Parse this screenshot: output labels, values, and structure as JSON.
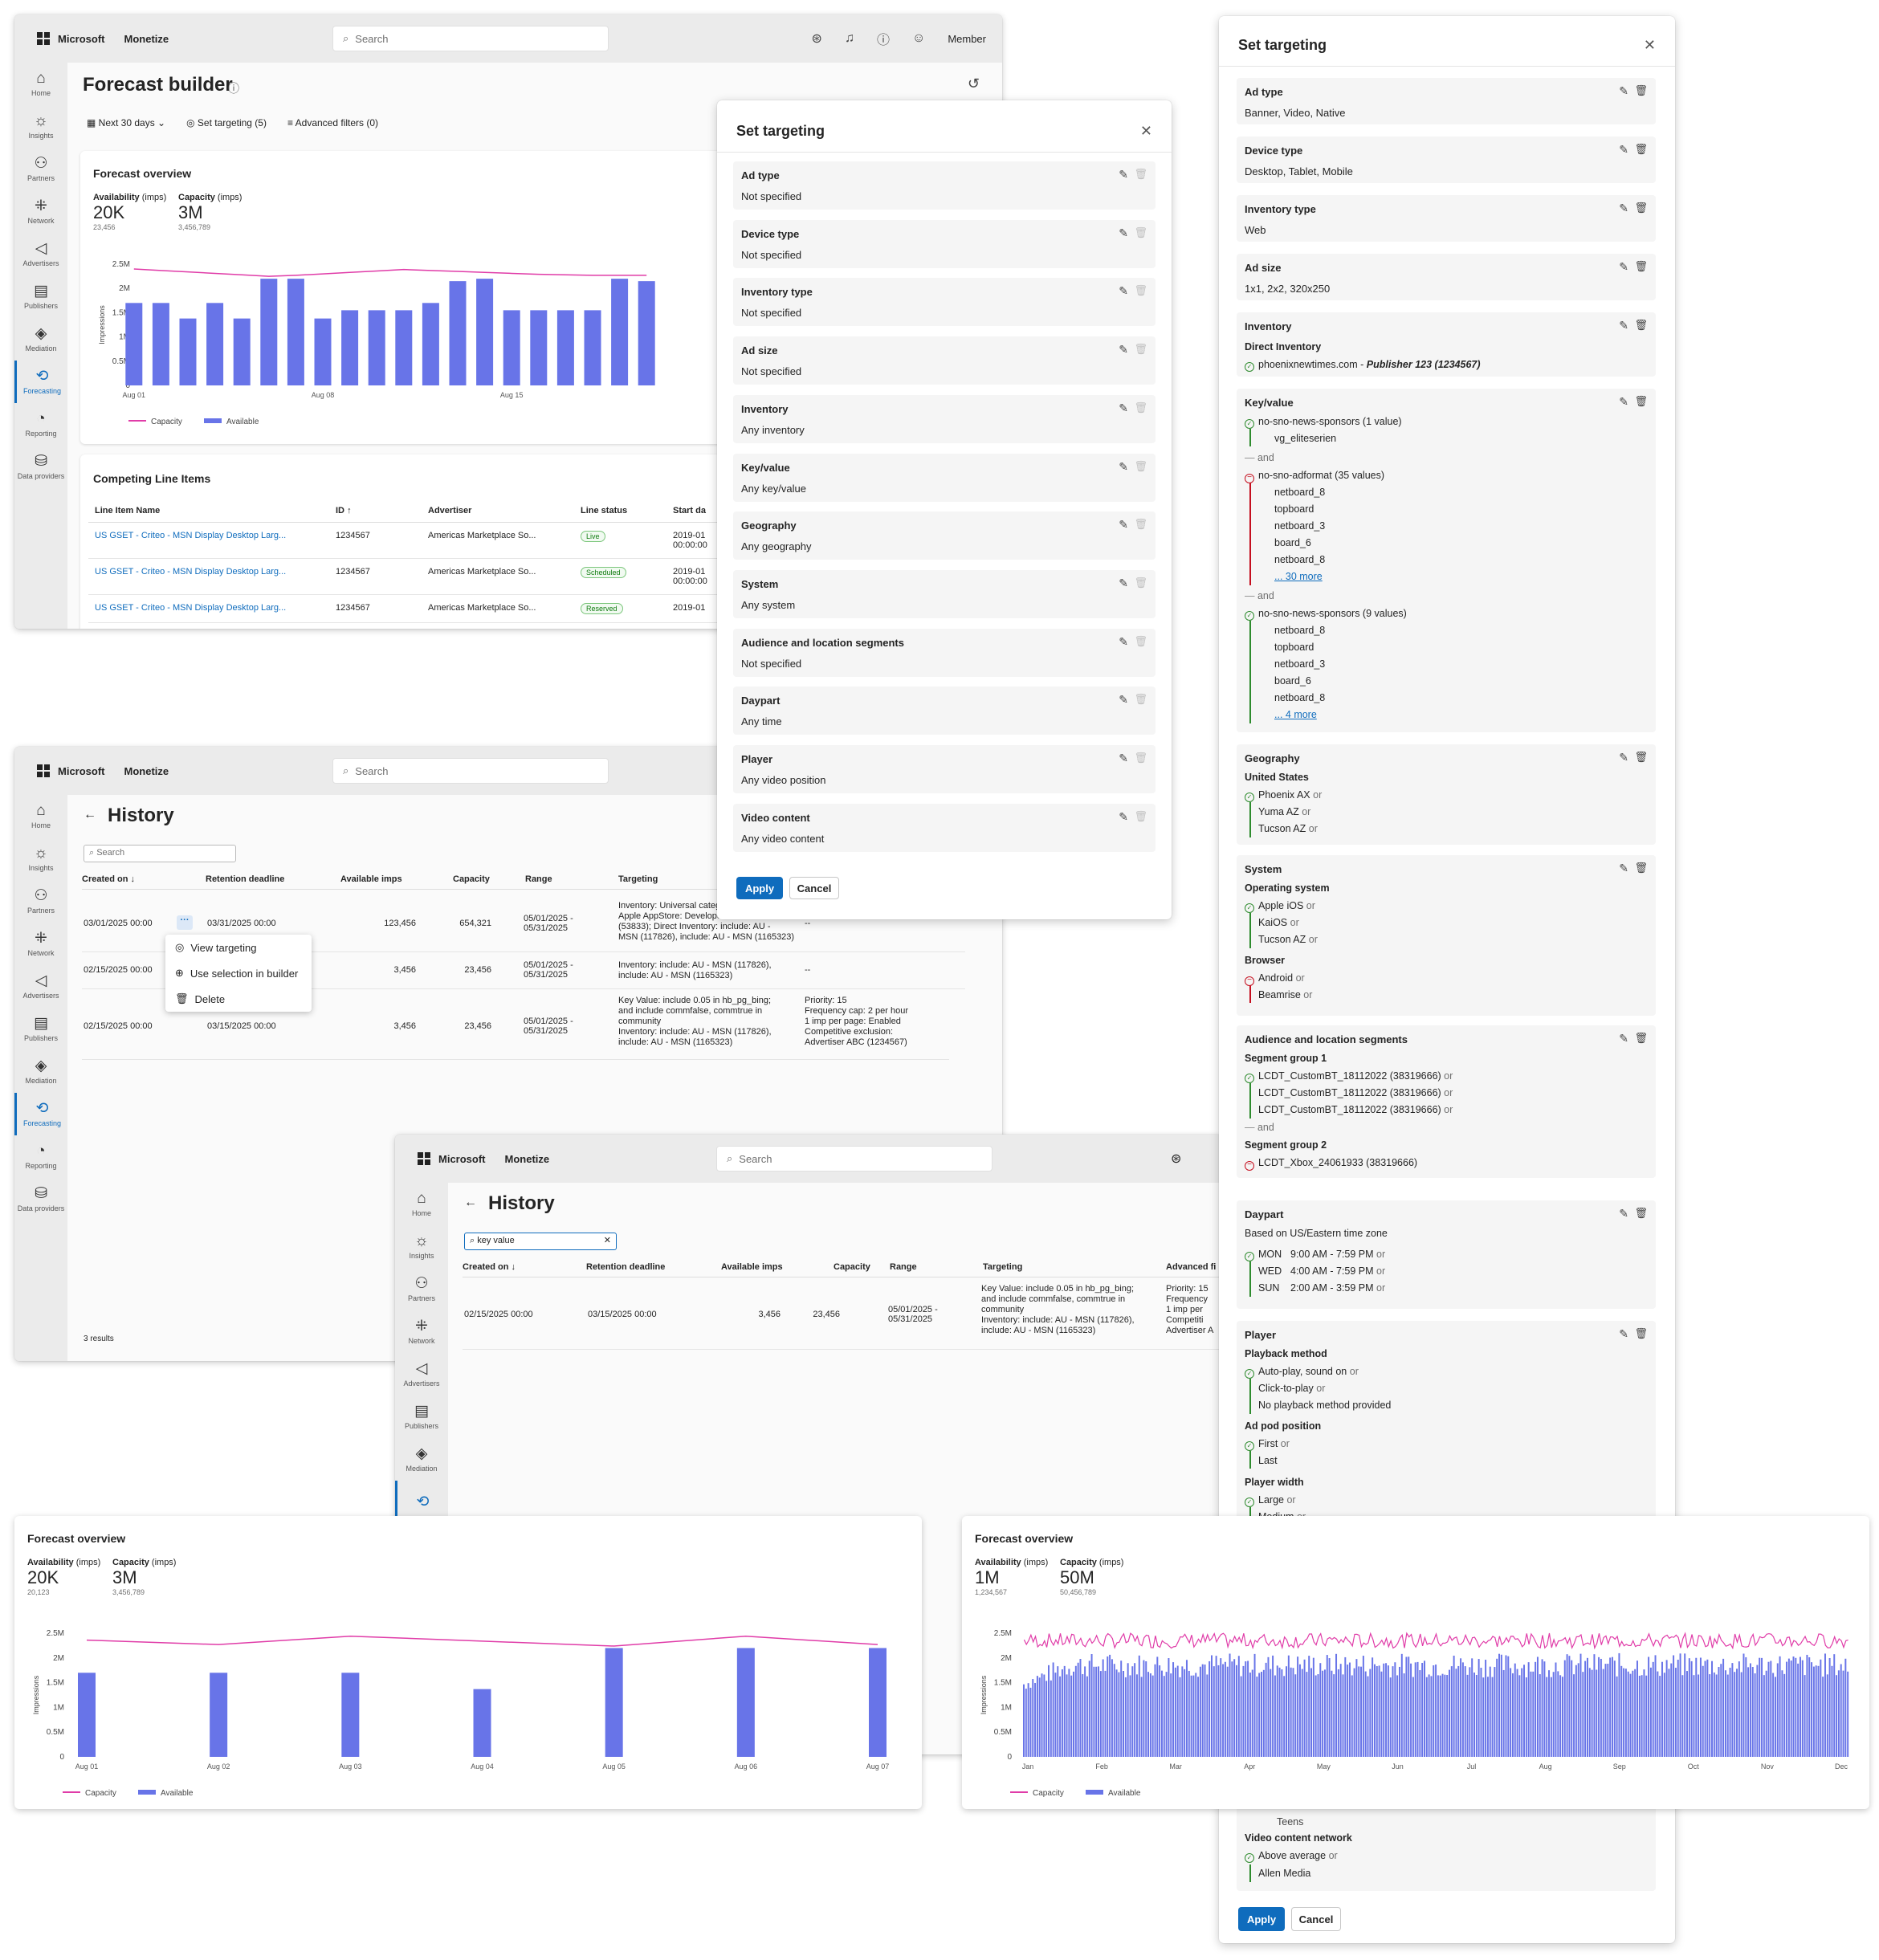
{
  "shell": {
    "brand": "Microsoft",
    "app": "Monetize",
    "search_placeholder": "Search",
    "member": "Member",
    "nav": [
      "Home",
      "Insights",
      "Partners",
      "Network",
      "Advertisers",
      "Publishers",
      "Mediation",
      "Forecasting",
      "Reporting",
      "Data providers"
    ],
    "active_nav": "Forecasting",
    "icons": {
      "home": "home-icon",
      "insights": "lightbulb-icon",
      "partners": "people-icon",
      "network": "network-icon",
      "advertisers": "megaphone-icon",
      "publishers": "news-icon",
      "mediation": "handshake-icon",
      "forecasting": "forecast-icon",
      "reporting": "report-icon",
      "data_providers": "database-icon"
    }
  },
  "forecast_builder": {
    "title": "Forecast builder",
    "filters": {
      "range": "Next 30 days",
      "targeting": "Set targeting (5)",
      "advanced": "Advanced filters (0)"
    },
    "overview_title": "Forecast overview",
    "availability_label": "Availability",
    "imps": "(imps)",
    "capacity_label": "Capacity",
    "availability_value": "20K",
    "availability_exact": "23,456",
    "capacity_value": "3M",
    "capacity_exact": "3,456,789",
    "competing_title": "Competing Line Items",
    "columns": [
      "Line Item Name",
      "ID",
      "Advertiser",
      "Line status",
      "Start da"
    ],
    "rows": [
      {
        "name": "US GSET - Criteo - MSN Display Desktop Larg...",
        "id": "1234567",
        "advertiser": "Americas Marketplace So...",
        "status": "Live",
        "start": "2019-01",
        "time": "00:00:00"
      },
      {
        "name": "US GSET - Criteo - MSN Display Desktop Larg...",
        "id": "1234567",
        "advertiser": "Americas Marketplace So...",
        "status": "Scheduled",
        "start": "2019-01",
        "time": "00:00:00"
      },
      {
        "name": "US GSET - Criteo - MSN Display Desktop Larg...",
        "id": "1234567",
        "advertiser": "Americas Marketplace So...",
        "status": "Reserved",
        "start": "2019-01",
        "time": ""
      }
    ]
  },
  "targeting_short": {
    "title": "Set targeting",
    "sections": [
      {
        "title": "Ad type",
        "value": "Not specified"
      },
      {
        "title": "Device type",
        "value": "Not specified"
      },
      {
        "title": "Inventory type",
        "value": "Not specified"
      },
      {
        "title": "Ad size",
        "value": "Not specified"
      },
      {
        "title": "Inventory",
        "value": "Any inventory"
      },
      {
        "title": "Key/value",
        "value": "Any key/value"
      },
      {
        "title": "Geography",
        "value": "Any geography"
      },
      {
        "title": "System",
        "value": "Any system"
      },
      {
        "title": "Audience and location segments",
        "value": "Not specified"
      },
      {
        "title": "Daypart",
        "value": "Any time"
      },
      {
        "title": "Player",
        "value": "Any video position"
      },
      {
        "title": "Video content",
        "value": "Any video content"
      }
    ],
    "apply": "Apply",
    "cancel": "Cancel"
  },
  "history1": {
    "title": "History",
    "search_placeholder": "Search",
    "columns": [
      "Created on",
      "Retention deadline",
      "Available imps",
      "Capacity",
      "Range",
      "Targeting"
    ],
    "rows": [
      {
        "created": "03/01/2025 00:00",
        "retention": "03/31/2025 00:00",
        "avail": "123,456",
        "capacity": "654,321",
        "range": "05/01/2025 - 05/31/2025",
        "t1": "Inventory: Universal catego",
        "t2": "Apple AppStore: Developer Tools",
        "t3": "(53833); Direct Inventory: include: AU -",
        "t4": "MSN (117826), include: AU - MSN (1165323)",
        "adv": "--"
      },
      {
        "created": "02/15/2025 00:00",
        "retention": "",
        "avail": "3,456",
        "capacity": "23,456",
        "range": "05/01/2025 - 05/31/2025",
        "t1": "Inventory: include: AU - MSN (117826),",
        "t2": "include: AU - MSN (1165323)",
        "adv": "--"
      },
      {
        "created": "02/15/2025 00:00",
        "retention": "03/15/2025 00:00",
        "avail": "3,456",
        "capacity": "23,456",
        "range": "05/01/2025 - 05/31/2025",
        "t1": "Key Value: include 0.05 in hb_pg_bing;",
        "t2": "and include commfalse, commtrue in",
        "t3": "community",
        "t4": "Inventory: include: AU - MSN (117826),",
        "t5": "include: AU - MSN (1165323)",
        "a1": "Priority: 15",
        "a2": "Frequency cap: 2 per hour",
        "a3": "1 imp per page: Enabled",
        "a4": "Competitive exclusion:",
        "a5": "Advertiser ABC (1234567)"
      }
    ],
    "menu": [
      "View targeting",
      "Use selection in builder",
      "Delete"
    ],
    "results": "3 results"
  },
  "history2": {
    "title": "History",
    "search_value": "key value",
    "columns": [
      "Created on",
      "Retention deadline",
      "Available imps",
      "Capacity",
      "Range",
      "Targeting",
      "Advanced fi"
    ],
    "row": {
      "created": "02/15/2025 00:00",
      "retention": "03/15/2025 00:00",
      "avail": "3,456",
      "capacity": "23,456",
      "range": "05/01/2025 - 05/31/2025",
      "t1": "Key Value: include 0.05 in hb_pg_bing;",
      "t2": "and include commfalse, commtrue in",
      "t3": "community",
      "t4": "Inventory: include: AU - MSN (117826),",
      "t5": "include: AU - MSN (1165323)",
      "a1": "Priority: 15",
      "a2": "Frequency",
      "a3": "1 imp per",
      "a4": "Competiti",
      "a5": "Advertiser A"
    }
  },
  "targeting_full": {
    "title": "Set targeting",
    "ad_type": {
      "title": "Ad type",
      "value": "Banner, Video, Native"
    },
    "device_type": {
      "title": "Device type",
      "value": "Desktop, Tablet, Mobile"
    },
    "inventory_type": {
      "title": "Inventory type",
      "value": "Web"
    },
    "ad_size": {
      "title": "Ad size",
      "value": "1x1, 2x2, 320x250"
    },
    "inventory": {
      "title": "Inventory",
      "sub": "Direct Inventory",
      "item": "phoenixnewtimes.com - ",
      "item_em": "Publisher 123 (1234567)"
    },
    "keyvalue": {
      "title": "Key/value",
      "g1": "no-sno-news-sponsors (1 value)",
      "g1v": "vg_eliteserien",
      "and": "and",
      "g2": "no-sno-adformat (35 values)",
      "g2v": [
        "netboard_8",
        "topboard",
        "netboard_3",
        "board_6",
        "netboard_8"
      ],
      "g2more": "... 30 more",
      "g3": "no-sno-news-sponsors (9 values)",
      "g3v": [
        "netboard_8",
        "topboard",
        "netboard_3",
        "board_6",
        "netboard_8"
      ],
      "g3more": "... 4 more"
    },
    "geography": {
      "title": "Geography",
      "sub": "United States",
      "items": [
        "Phoenix AX",
        "Yuma AZ",
        "Tucson AZ"
      ]
    },
    "system": {
      "title": "System",
      "os": "Operating system",
      "os_items": [
        "Apple iOS",
        "KaiOS",
        "Tucson AZ"
      ],
      "browser": "Browser",
      "browser_items": [
        "Android",
        "Beamrise"
      ]
    },
    "audience": {
      "title": "Audience and location segments",
      "g1": "Segment group 1",
      "g1items": [
        "LCDT_CustomBT_18112022 (38319666)",
        "LCDT_CustomBT_18112022 (38319666)",
        "LCDT_CustomBT_18112022 (38319666)"
      ],
      "and": "and",
      "g2": "Segment group 2",
      "g2item": "LCDT_Xbox_24061933 (38319666)"
    },
    "daypart": {
      "title": "Daypart",
      "tz": "Based on US/Eastern time zone",
      "rows": [
        {
          "d": "MON",
          "t": "9:00 AM - 7:59 PM"
        },
        {
          "d": "WED",
          "t": "4:00 AM - 7:59 PM"
        },
        {
          "d": "SUN",
          "t": "2:00 AM - 3:59 PM"
        }
      ]
    },
    "player": {
      "title": "Player",
      "pm": "Playback method",
      "pm_items": [
        "Auto-play, sound on",
        "Click-to-play",
        "No playback method provided"
      ],
      "pod": "Ad pod position",
      "pod_items": [
        "First",
        "Last"
      ],
      "pw": "Player width",
      "pw_items": [
        "Large",
        "Medium"
      ]
    },
    "partial": {
      "teens": "Teens",
      "vcn": "Video content network",
      "vcn_items": [
        "Above average",
        "Allen Media"
      ]
    },
    "or": "or",
    "apply": "Apply",
    "cancel": "Cancel"
  },
  "overview_a": {
    "title": "Forecast overview",
    "availability_value": "20K",
    "availability_exact": "20,123",
    "capacity_value": "3M",
    "capacity_exact": "3,456,789"
  },
  "overview_b": {
    "title": "Forecast overview",
    "availability_value": "1M",
    "availability_exact": "1,234,567",
    "capacity_value": "50M",
    "capacity_exact": "50,456,789"
  },
  "legend": {
    "capacity": "Capacity",
    "available": "Available"
  },
  "colors": {
    "accent": "#0f6cbd",
    "bar": "#6874e8",
    "capacity_line": "#e03ca8"
  },
  "chart_data": [
    {
      "type": "bar",
      "title": "Forecast overview",
      "ylabel": "Impressions",
      "ylim": [
        0,
        2500000
      ],
      "yticks": [
        "2.5M",
        "2M",
        "1.5M",
        "1M",
        "0.5M",
        "0"
      ],
      "x_tick_labels": [
        "Aug 01",
        "Aug 08",
        "Aug 15"
      ],
      "series": [
        {
          "name": "Available",
          "values": [
            1700000,
            1700000,
            1380000,
            1700000,
            1380000,
            2200000,
            2200000,
            1380000,
            1550000,
            1550000,
            1550000,
            1700000,
            2150000,
            2200000,
            1550000,
            1550000,
            1550000,
            1550000,
            2200000,
            2150000
          ]
        },
        {
          "name": "Capacity",
          "values": [
            2400000,
            2370000,
            2340000,
            2310000,
            2280000,
            2250000,
            2270000,
            2300000,
            2330000,
            2360000,
            2390000,
            2370000,
            2350000,
            2330000,
            2310000,
            2290000,
            2280000,
            2270000,
            2270000,
            2270000
          ]
        }
      ]
    },
    {
      "type": "bar",
      "title": "Forecast overview",
      "ylabel": "Impressions",
      "ylim": [
        0,
        2500000
      ],
      "yticks": [
        "2.5M",
        "2M",
        "1.5M",
        "1M",
        "0.5M",
        "0"
      ],
      "categories": [
        "Aug 01",
        "Aug 02",
        "Aug 03",
        "Aug 04",
        "Aug 05",
        "Aug 06",
        "Aug 07"
      ],
      "series": [
        {
          "name": "Available",
          "values": [
            1700000,
            1700000,
            1700000,
            1370000,
            2200000,
            2200000,
            2200000
          ]
        },
        {
          "name": "Capacity",
          "values": [
            2360000,
            2270000,
            2440000,
            2340000,
            2240000,
            2440000,
            2270000
          ]
        }
      ]
    },
    {
      "type": "bar",
      "title": "Forecast overview",
      "ylabel": "Impressions",
      "ylim": [
        0,
        2500000
      ],
      "yticks": [
        "2.5M",
        "2M",
        "1.5M",
        "1M",
        "0.5M",
        "0"
      ],
      "x_tick_labels": [
        "Jan",
        "Feb",
        "Mar",
        "Apr",
        "May",
        "Jun",
        "Jul",
        "Aug",
        "Sep",
        "Oct",
        "Nov",
        "Dec"
      ],
      "series": [
        {
          "name": "Available",
          "values_range": [
            1000000,
            2100000
          ],
          "points": 365
        },
        {
          "name": "Capacity",
          "values_range": [
            2200000,
            2500000
          ],
          "points": 365
        }
      ]
    }
  ]
}
